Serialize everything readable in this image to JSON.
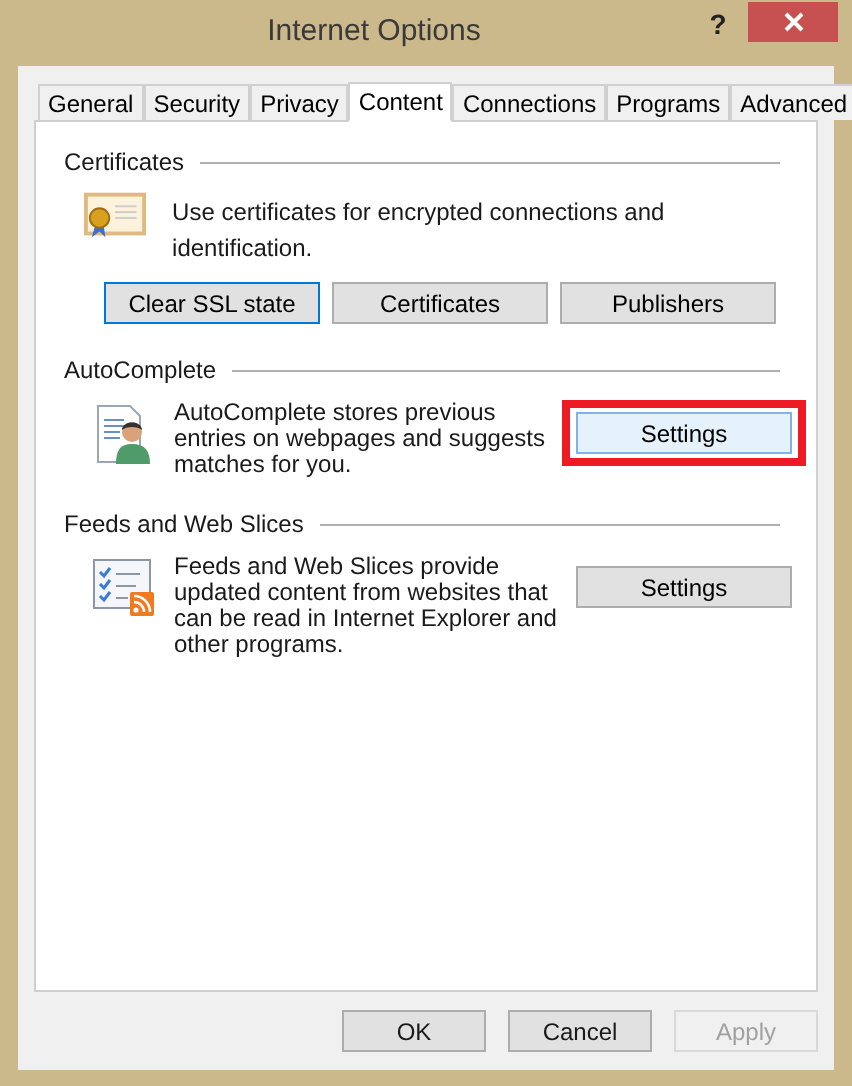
{
  "window": {
    "title": "Internet Options",
    "help": "?"
  },
  "tabs": [
    {
      "label": "General",
      "selected": false
    },
    {
      "label": "Security",
      "selected": false
    },
    {
      "label": "Privacy",
      "selected": false
    },
    {
      "label": "Content",
      "selected": true
    },
    {
      "label": "Connections",
      "selected": false
    },
    {
      "label": "Programs",
      "selected": false
    },
    {
      "label": "Advanced",
      "selected": false
    }
  ],
  "certificates": {
    "heading": "Certificates",
    "description": "Use certificates for encrypted connections and identification.",
    "buttons": [
      {
        "label": "Clear SSL state",
        "focused": true
      },
      {
        "label": "Certificates",
        "focused": false
      },
      {
        "label": "Publishers",
        "focused": false
      }
    ]
  },
  "autocomplete": {
    "heading": "AutoComplete",
    "description": "AutoComplete stores previous entries on webpages and suggests matches for you.",
    "button": {
      "label": "Settings",
      "highlighted": true
    }
  },
  "feeds": {
    "heading": "Feeds and Web Slices",
    "description": "Feeds and Web Slices provide updated content from websites that can be read in Internet Explorer and other programs.",
    "button": {
      "label": "Settings",
      "highlighted": false
    }
  },
  "footer_buttons": [
    {
      "label": "OK",
      "disabled": false
    },
    {
      "label": "Cancel",
      "disabled": false
    },
    {
      "label": "Apply",
      "disabled": true
    }
  ]
}
